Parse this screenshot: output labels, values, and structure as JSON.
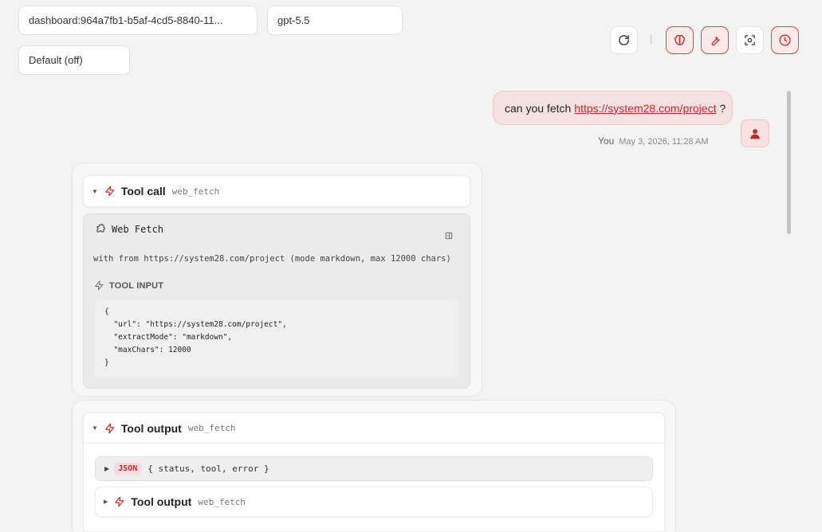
{
  "top": {
    "session_select": "dashboard:964a7fb1-b5af-4cd5-8840-11...",
    "model_select": "gpt-5.5",
    "thinking_select": "Default (off)"
  },
  "toolbar": {
    "icons": [
      "refresh-icon",
      "brain-icon",
      "wrench-icon",
      "focus-icon",
      "clock-icon"
    ],
    "separator": "|"
  },
  "user_message": {
    "text_before": "can you fetch",
    "link": "https://system28.com/project",
    "text_after": "?",
    "author": "You",
    "timestamp": "May 3, 2026, 11:28 AM"
  },
  "tool_call": {
    "title": "Tool call",
    "tool_name": "web_fetch",
    "card_title": "Web Fetch",
    "summary": "with from https://system28.com/project (mode markdown, max 12000 chars)",
    "input_label": "TOOL INPUT",
    "input_lines": [
      "{",
      "  \"url\": \"https://system28.com/project\",",
      "  \"extractMode\": \"markdown\",",
      "  \"maxChars\": 12000",
      "}"
    ]
  },
  "tool_output": {
    "title": "Tool output",
    "tool_name": "web_fetch",
    "json_badge": "JSON",
    "json_summary": "{ status, tool, error }",
    "nested_title": "Tool output",
    "nested_tool_name": "web_fetch"
  },
  "colors": {
    "accent": "#c62828",
    "accent_bg": "#f6e1e1",
    "background": "#f3f3f4"
  }
}
